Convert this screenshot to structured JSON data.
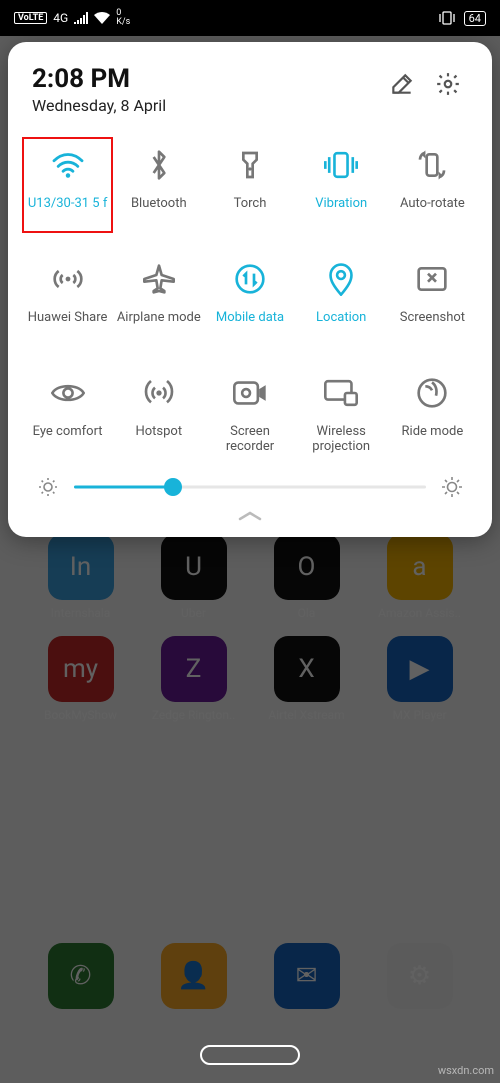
{
  "statusbar": {
    "volte": "VoLTE",
    "signal": "4G",
    "speed_num": "0",
    "speed_unit": "K/s",
    "battery": "64"
  },
  "panel": {
    "time": "2:08 PM",
    "date": "Wednesday, 8 April",
    "brightness_pct": 28
  },
  "tiles": [
    {
      "key": "wifi",
      "label": "U13/30-31 5 f",
      "active": true,
      "highlight": true
    },
    {
      "key": "bluetooth",
      "label": "Bluetooth",
      "active": false,
      "highlight": false
    },
    {
      "key": "torch",
      "label": "Torch",
      "active": false,
      "highlight": false
    },
    {
      "key": "vibration",
      "label": "Vibration",
      "active": true,
      "highlight": false
    },
    {
      "key": "autorotate",
      "label": "Auto-rotate",
      "active": false,
      "highlight": false
    },
    {
      "key": "huaweishare",
      "label": "Huawei Share",
      "active": false,
      "highlight": false
    },
    {
      "key": "airplane",
      "label": "Airplane mode",
      "active": false,
      "highlight": false
    },
    {
      "key": "mobiledata",
      "label": "Mobile data",
      "active": true,
      "highlight": false
    },
    {
      "key": "location",
      "label": "Location",
      "active": true,
      "highlight": false
    },
    {
      "key": "screenshot",
      "label": "Screenshot",
      "active": false,
      "highlight": false
    },
    {
      "key": "eyecomfort",
      "label": "Eye comfort",
      "active": false,
      "highlight": false
    },
    {
      "key": "hotspot",
      "label": "Hotspot",
      "active": false,
      "highlight": false
    },
    {
      "key": "screenrec",
      "label": "Screen recorder",
      "active": false,
      "highlight": false
    },
    {
      "key": "projection",
      "label": "Wireless projection",
      "active": false,
      "highlight": false
    },
    {
      "key": "ridemode",
      "label": "Ride mode",
      "active": false,
      "highlight": false
    }
  ],
  "home_apps_r1": [
    {
      "label": "Internshala",
      "color": "#3aa0e0",
      "glyph": "In"
    },
    {
      "label": "Uber",
      "color": "#111",
      "glyph": "U"
    },
    {
      "label": "Ola",
      "color": "#111",
      "glyph": "O"
    },
    {
      "label": "Amazon Assis..",
      "color": "#f4b400",
      "glyph": "a"
    }
  ],
  "home_apps_r2": [
    {
      "label": "BookMyShow",
      "color": "#c62828",
      "glyph": "my"
    },
    {
      "label": "Zedge Rington..",
      "color": "#6a1b9a",
      "glyph": "Z"
    },
    {
      "label": "Airtel Xstream",
      "color": "#111",
      "glyph": "X"
    },
    {
      "label": "MX Player",
      "color": "#1565c0",
      "glyph": "▶"
    }
  ],
  "dock": [
    {
      "label": "",
      "color": "#2e7d32",
      "glyph": "✆"
    },
    {
      "label": "",
      "color": "#f9a825",
      "glyph": "👤"
    },
    {
      "label": "",
      "color": "#1565c0",
      "glyph": "✉"
    },
    {
      "label": "",
      "color": "#eeeeee",
      "glyph": "⚙"
    }
  ],
  "watermark": "wsxdn.com",
  "colors": {
    "accent": "#18b3d9"
  }
}
